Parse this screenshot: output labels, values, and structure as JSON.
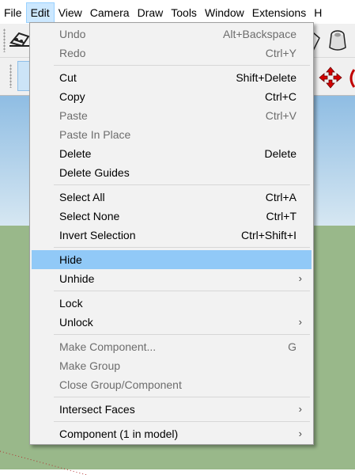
{
  "menubar": {
    "items": [
      "File",
      "Edit",
      "View",
      "Camera",
      "Draw",
      "Tools",
      "Window",
      "Extensions",
      "H"
    ],
    "active_index": 1
  },
  "toolbar": {
    "icons": [
      "eraser-icon",
      "paint-bucket-icon",
      "move-icon",
      "component-icon"
    ]
  },
  "edit_menu": {
    "items": [
      {
        "label": "Undo",
        "shortcut": "Alt+Backspace",
        "enabled": false
      },
      {
        "label": "Redo",
        "shortcut": "Ctrl+Y",
        "enabled": false
      },
      {
        "label": "Cut",
        "shortcut": "Shift+Delete",
        "enabled": true
      },
      {
        "label": "Copy",
        "shortcut": "Ctrl+C",
        "enabled": true
      },
      {
        "label": "Paste",
        "shortcut": "Ctrl+V",
        "enabled": false
      },
      {
        "label": "Paste In Place",
        "shortcut": "",
        "enabled": false
      },
      {
        "label": "Delete",
        "shortcut": "Delete",
        "enabled": true
      },
      {
        "label": "Delete Guides",
        "shortcut": "",
        "enabled": true
      },
      {
        "label": "Select All",
        "shortcut": "Ctrl+A",
        "enabled": true
      },
      {
        "label": "Select None",
        "shortcut": "Ctrl+T",
        "enabled": true
      },
      {
        "label": "Invert Selection",
        "shortcut": "Ctrl+Shift+I",
        "enabled": true
      },
      {
        "label": "Hide",
        "shortcut": "",
        "enabled": true,
        "highlighted": true
      },
      {
        "label": "Unhide",
        "shortcut": "",
        "enabled": true,
        "submenu": true
      },
      {
        "label": "Lock",
        "shortcut": "",
        "enabled": true
      },
      {
        "label": "Unlock",
        "shortcut": "",
        "enabled": true,
        "submenu": true
      },
      {
        "label": "Make Component...",
        "shortcut": "G",
        "enabled": false
      },
      {
        "label": "Make Group",
        "shortcut": "",
        "enabled": false
      },
      {
        "label": "Close Group/Component",
        "shortcut": "",
        "enabled": false
      },
      {
        "label": "Intersect Faces",
        "shortcut": "",
        "enabled": true,
        "submenu": true
      },
      {
        "label": "Component (1 in model)",
        "shortcut": "",
        "enabled": true,
        "submenu": true
      }
    ],
    "submenu_glyph": "›"
  },
  "colors": {
    "menu_bg": "#f2f2f2",
    "highlight": "#91c9f7",
    "disabled_text": "#6d6d6d",
    "active_menu": "#cce8ff",
    "ground": "#99b88a",
    "sky_top": "#8fbde3"
  }
}
